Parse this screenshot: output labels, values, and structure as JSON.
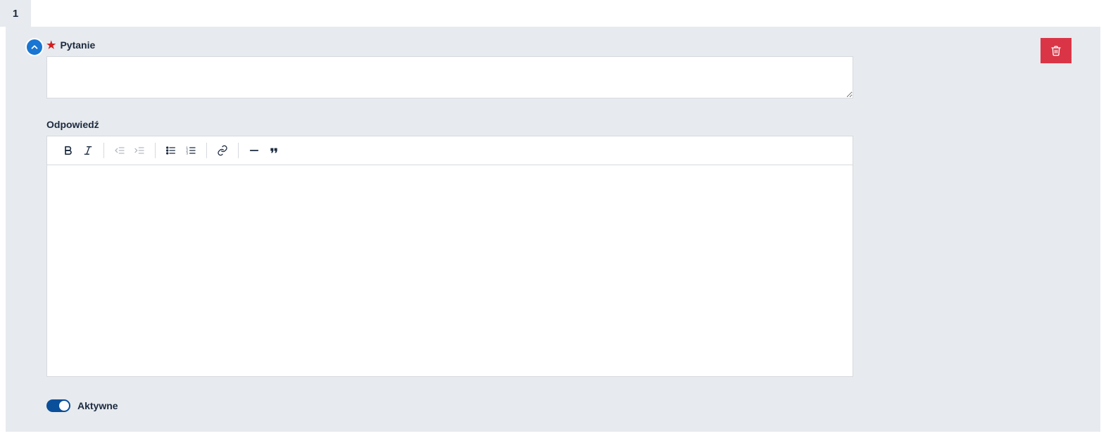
{
  "tab": {
    "label": "1"
  },
  "question": {
    "label": "Pytanie",
    "required": true,
    "value": ""
  },
  "answer": {
    "label": "Odpowiedź",
    "value": ""
  },
  "toolbar": {
    "bold": "bold",
    "italic": "italic",
    "outdent": "outdent",
    "indent": "indent",
    "ul": "bulleted-list",
    "ol": "numbered-list",
    "link": "link",
    "hr": "horizontal-rule",
    "quote": "blockquote"
  },
  "toggle": {
    "label": "Aktywne",
    "on": true
  },
  "actions": {
    "collapse": "collapse",
    "delete": "delete"
  }
}
